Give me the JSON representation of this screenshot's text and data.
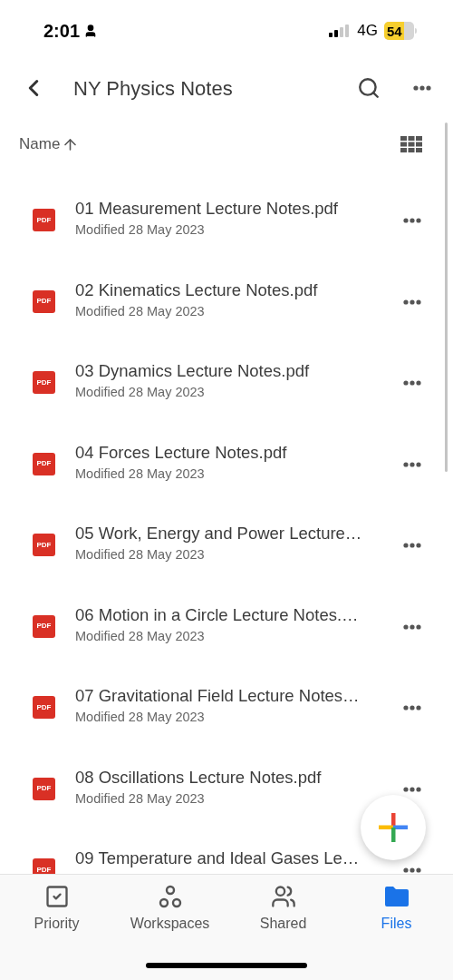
{
  "status_bar": {
    "time": "2:01",
    "network": "4G",
    "battery": "54"
  },
  "header": {
    "title": "NY Physics Notes"
  },
  "sort": {
    "label": "Name"
  },
  "files": [
    {
      "badge": "PDF",
      "name": "01 Measurement Lecture Notes.pdf",
      "modified": "Modified 28 May 2023"
    },
    {
      "badge": "PDF",
      "name": "02 Kinematics Lecture Notes.pdf",
      "modified": "Modified 28 May 2023"
    },
    {
      "badge": "PDF",
      "name": "03 Dynamics Lecture Notes.pdf",
      "modified": "Modified 28 May 2023"
    },
    {
      "badge": "PDF",
      "name": "04 Forces Lecture Notes.pdf",
      "modified": "Modified 28 May 2023"
    },
    {
      "badge": "PDF",
      "name": "05 Work, Energy and Power Lecture…",
      "modified": "Modified 28 May 2023"
    },
    {
      "badge": "PDF",
      "name": "06 Motion in a Circle Lecture Notes.…",
      "modified": "Modified 28 May 2023"
    },
    {
      "badge": "PDF",
      "name": "07 Gravitational Field Lecture Notes…",
      "modified": "Modified 28 May 2023"
    },
    {
      "badge": "PDF",
      "name": "08 Oscillations Lecture Notes.pdf",
      "modified": "Modified 28 May 2023"
    },
    {
      "badge": "PDF",
      "name": "09 Temperature and Ideal Gases Le…"
    }
  ],
  "nav": [
    {
      "kind": "priority",
      "label": "Priority",
      "selected": false
    },
    {
      "kind": "workspaces",
      "label": "Workspaces",
      "selected": false
    },
    {
      "kind": "shared",
      "label": "Shared",
      "selected": false
    },
    {
      "kind": "files",
      "label": "Files",
      "selected": true
    }
  ]
}
